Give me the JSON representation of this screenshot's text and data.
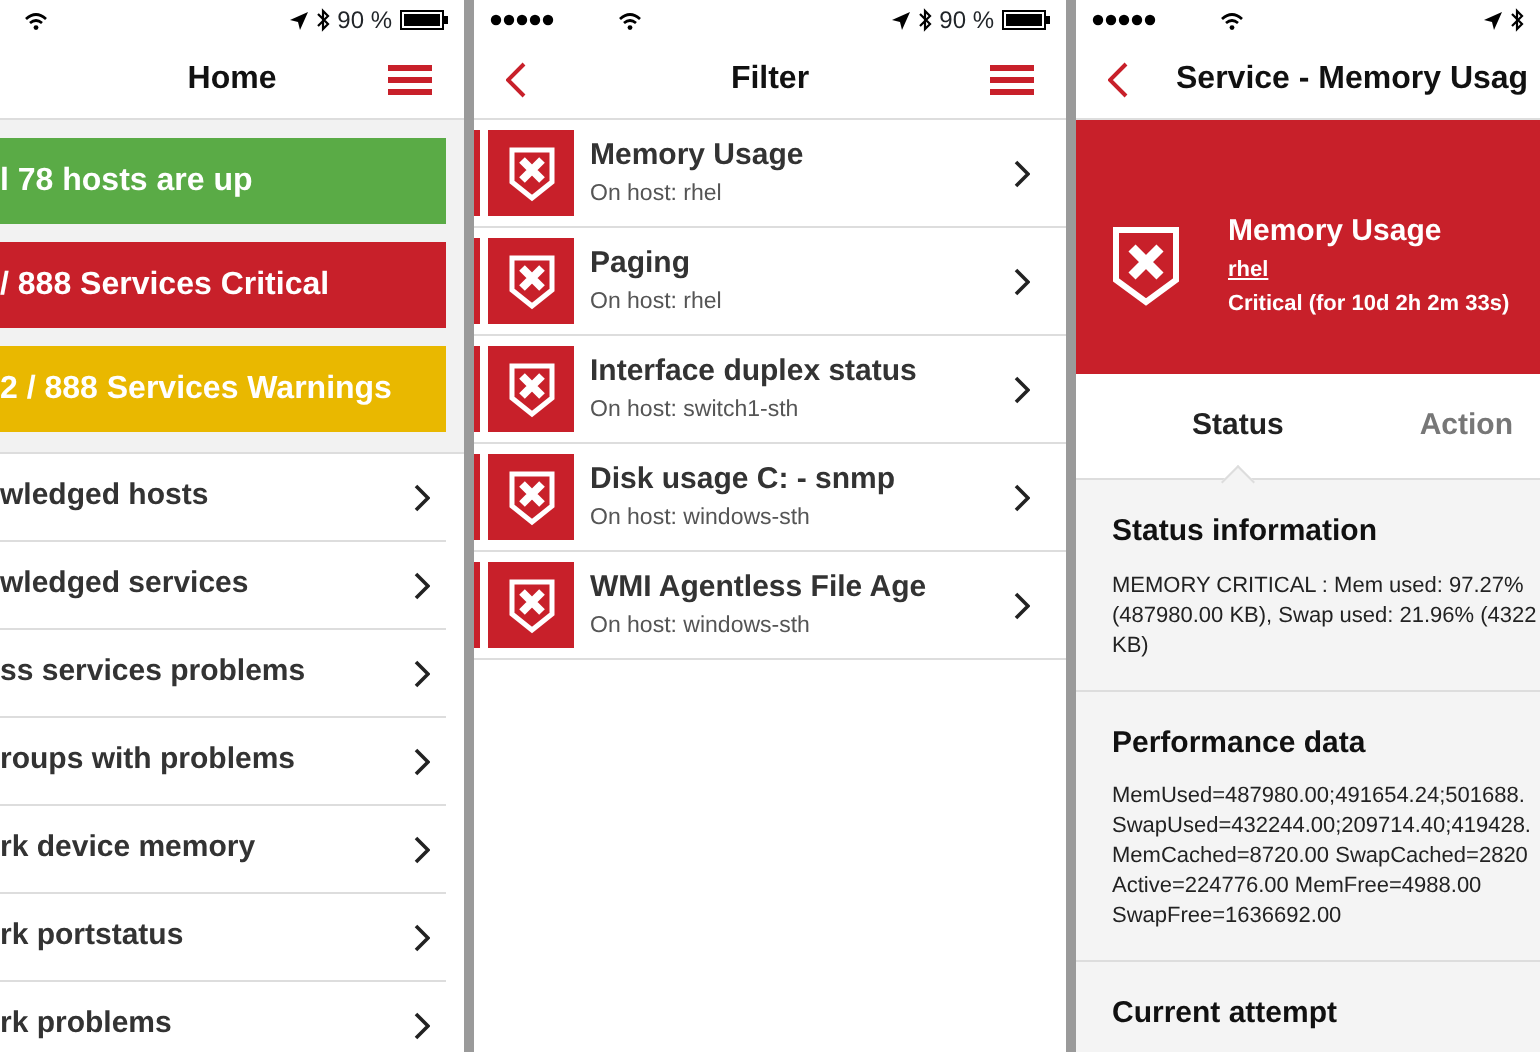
{
  "home_screen": {
    "status_bar": {
      "signal_dots": false,
      "battery": "90 %"
    },
    "nav": {
      "back": false,
      "title": "Home",
      "menu": true
    },
    "banners": [
      {
        "text": "l 78 hosts are up",
        "color": "#5aab46"
      },
      {
        "text": "/ 888 Services Critical",
        "color": "#c8202a"
      },
      {
        "text": "2 / 888 Services Warnings",
        "color": "#e9b800"
      }
    ],
    "items": [
      "wledged hosts",
      "wledged services",
      "ss services problems",
      "roups with problems",
      "rk device memory",
      "rk portstatus",
      "rk problems"
    ]
  },
  "filter_screen": {
    "status_bar": {
      "signal_dots": true,
      "battery": "90 %"
    },
    "nav": {
      "back": true,
      "title": "Filter",
      "menu": true
    },
    "items": [
      {
        "title": "Memory Usage",
        "host": "On host: rhel",
        "kind": "critical"
      },
      {
        "title": "Paging",
        "host": "On host: rhel",
        "kind": "critical"
      },
      {
        "title": "Interface duplex status",
        "host": "On host: switch1-sth",
        "kind": "critical"
      },
      {
        "title": "Disk usage C: - snmp",
        "host": "On host: windows-sth",
        "kind": "critical"
      },
      {
        "title": "WMI Agentless File Age",
        "host": "On host: windows-sth",
        "kind": "critical"
      }
    ]
  },
  "service_screen": {
    "status_bar": {
      "signal_dots": true
    },
    "nav": {
      "back": true,
      "title": "Service - Memory Usag",
      "menu": false
    },
    "header": {
      "kind": "critical",
      "title": "Memory Usage",
      "host": "rhel",
      "state": "Critical (for 10d 2h 2m 33s)"
    },
    "tabs": [
      {
        "label": "Status",
        "selected": true
      },
      {
        "label": "Action",
        "selected": false
      }
    ],
    "sections": [
      {
        "heading": "Status information",
        "lines": [
          "MEMORY CRITICAL : Mem used: 97.27%",
          "(487980.00 KB), Swap used: 21.96% (4322",
          "KB)"
        ]
      },
      {
        "heading": "Performance data",
        "lines": [
          "MemUsed=487980.00;491654.24;501688.",
          "SwapUsed=432244.00;209714.40;419428.",
          "MemCached=8720.00 SwapCached=2820",
          "Active=224776.00 MemFree=4988.00",
          "SwapFree=1636692.00"
        ]
      },
      {
        "heading": "Current attempt"
      }
    ]
  }
}
